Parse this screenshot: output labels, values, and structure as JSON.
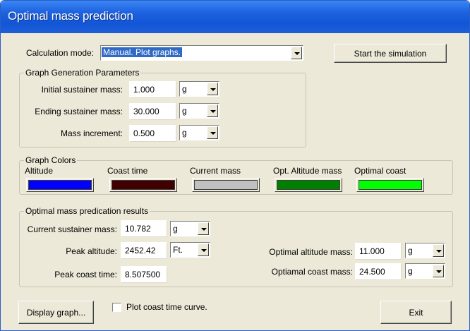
{
  "window": {
    "title": "Optimal mass prediction"
  },
  "mode": {
    "label": "Calculation mode:",
    "value": "Manual. Plot graphs."
  },
  "start_button": "Start the simulation",
  "params": {
    "title": "Graph Generation Parameters",
    "rows": [
      {
        "label": "Initial sustainer mass:",
        "value": "1.000",
        "unit": "g"
      },
      {
        "label": "Ending sustainer mass:",
        "value": "30.000",
        "unit": "g"
      },
      {
        "label": "Mass increment:",
        "value": "0.500",
        "unit": "g"
      }
    ]
  },
  "colors": {
    "title": "Graph Colors",
    "items": [
      {
        "label": "Altitude",
        "color": "#0000ff"
      },
      {
        "label": "Coast time",
        "color": "#400000"
      },
      {
        "label": "Current mass",
        "color": "#c0c0c0"
      },
      {
        "label": "Opt. Altitude mass",
        "color": "#008000"
      },
      {
        "label": "Optimal coast",
        "color": "#00ff00"
      }
    ]
  },
  "results": {
    "title": "Optimal mass predication results",
    "current_mass": {
      "label": "Current sustainer mass:",
      "value": "10.782",
      "unit": "g"
    },
    "peak_altitude": {
      "label": "Peak altitude:",
      "value": "2452.42",
      "unit": "Ft."
    },
    "peak_coast": {
      "label": "Peak coast time:",
      "value": "8.507500"
    },
    "opt_altitude_mass": {
      "label": "Optimal altitude mass:",
      "value": "11.000",
      "unit": "g"
    },
    "opt_coast_mass": {
      "label": "Optiamal coast mass:",
      "value": "24.500",
      "unit": "g"
    }
  },
  "display_button": "Display graph...",
  "plot_coast_checkbox": {
    "label": "Plot coast time curve.",
    "checked": false
  },
  "exit_button": "Exit"
}
